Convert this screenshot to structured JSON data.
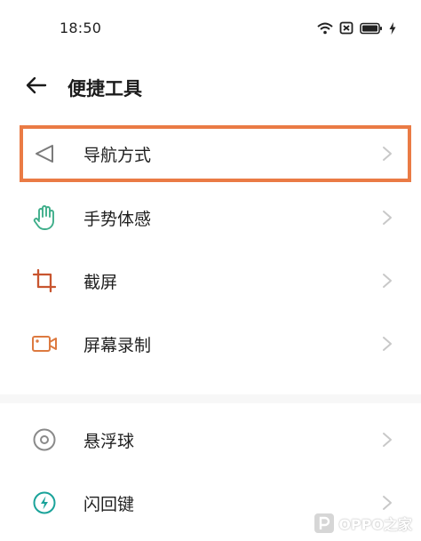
{
  "status_bar": {
    "time": "18:50",
    "icons": [
      "wifi-icon",
      "sim-blocked-icon",
      "battery-icon",
      "charging-icon"
    ]
  },
  "header": {
    "back_icon": "back-arrow-icon",
    "title": "便捷工具"
  },
  "items": [
    {
      "label": "导航方式",
      "icon": "navigation-triangle-icon",
      "icon_color": "#7a7a7a",
      "highlighted": true
    },
    {
      "label": "手势体感",
      "icon": "hand-gesture-icon",
      "icon_color": "#3fae8a"
    },
    {
      "label": "截屏",
      "icon": "crop-icon",
      "icon_color": "#c8552f"
    },
    {
      "label": "屏幕录制",
      "icon": "video-record-icon",
      "icon_color": "#dd7a40"
    },
    {
      "label": "悬浮球",
      "icon": "floating-ball-icon",
      "icon_color": "#8a8a8a"
    },
    {
      "label": "闪回键",
      "icon": "flashback-icon",
      "icon_color": "#1aa39a"
    }
  ],
  "colors": {
    "highlight_border": "#ea7b45",
    "chevron": "#c8c8c8"
  },
  "watermark": {
    "text": "OPPO之家",
    "logo_icon": "p-logo-icon"
  }
}
